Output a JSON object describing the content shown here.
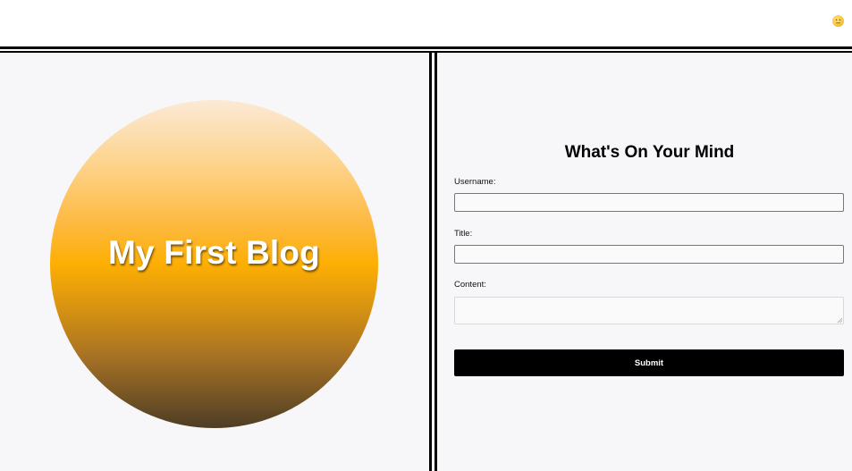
{
  "header": {
    "theme_toggle_icon": "sun-face-icon"
  },
  "hero": {
    "title": "My First Blog"
  },
  "form": {
    "title": "What's On Your Mind",
    "username_label": "Username:",
    "username_value": "",
    "title_label": "Title:",
    "title_value": "",
    "content_label": "Content:",
    "content_value": "",
    "submit_label": "Submit"
  },
  "colors": {
    "panel_background": "#f7f7f9",
    "divider": "#000000",
    "submit_background": "#000000",
    "circle_top": "#fce9d6",
    "circle_middle": "#fdaf03",
    "circle_bottom": "#4e3d25"
  }
}
